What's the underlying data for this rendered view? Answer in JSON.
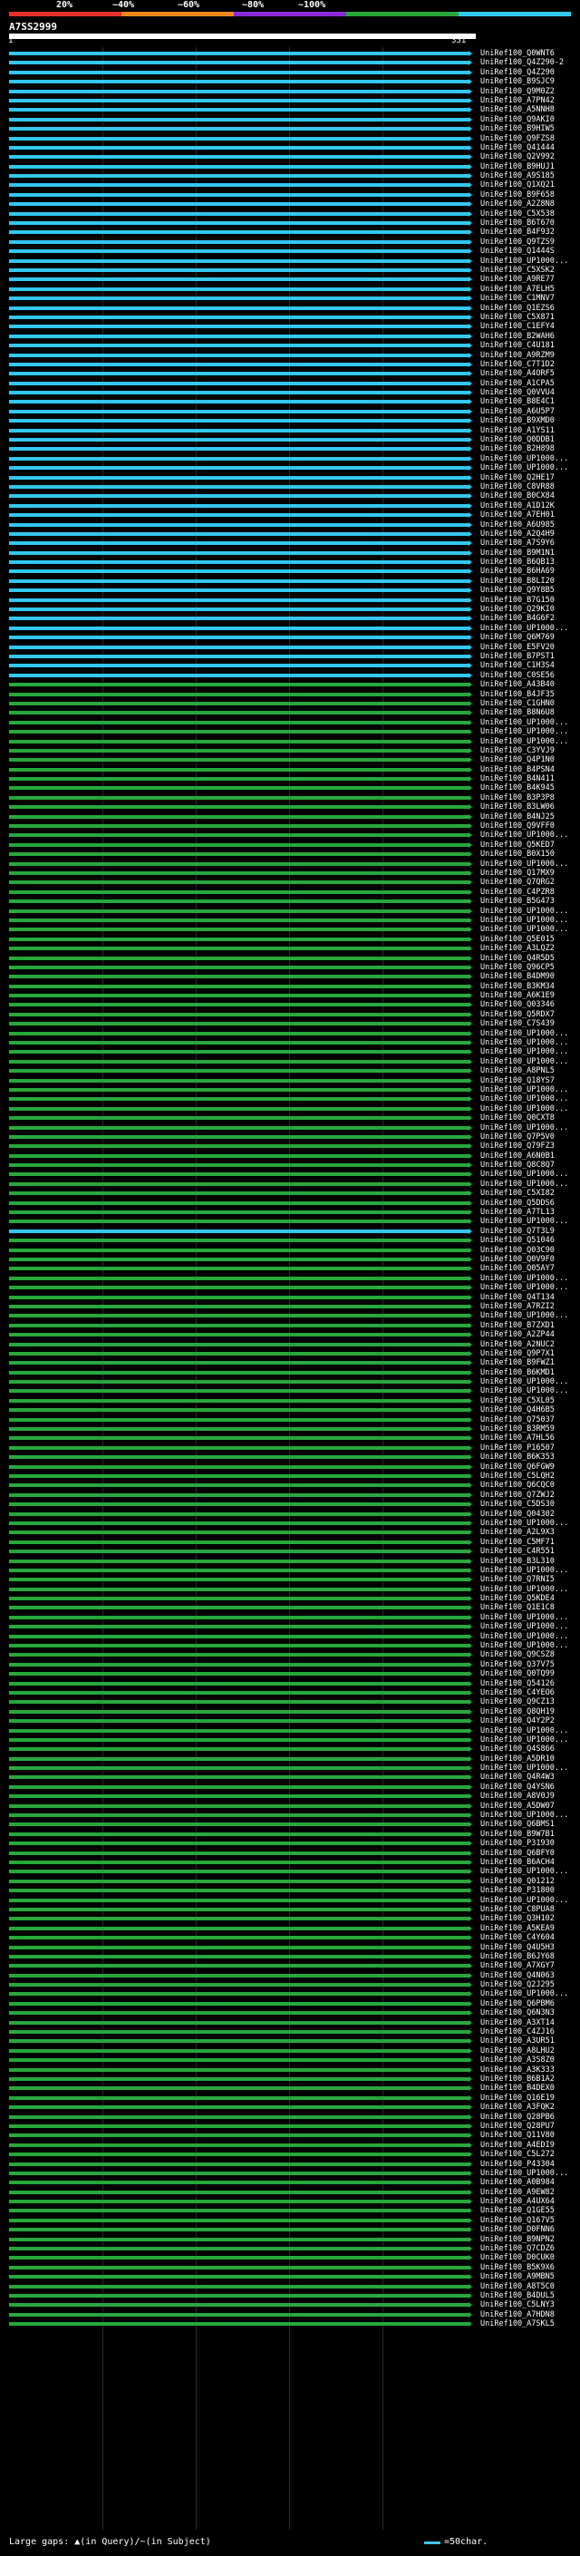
{
  "header": {
    "percent_labels": [
      "20%",
      "~40%",
      "~60%",
      "~80%",
      "~100%"
    ],
    "colors": [
      "#e8312a",
      "#f08a1d",
      "#8a2bd6",
      "#28a83c",
      "#32c8f0"
    ]
  },
  "query": {
    "id": "A7SS2999",
    "start": "1",
    "end": "351"
  },
  "hits": [
    "UniRef100_Q0WNT6",
    "UniRef100_Q4Z290-2",
    "UniRef100_Q4Z290",
    "UniRef100_B9SJC9",
    "UniRef100_Q9M0Z2",
    "UniRef100_A7PN42",
    "UniRef100_A5NNH8",
    "UniRef100_Q9AKI0",
    "UniRef100_B9HIW5",
    "UniRef100_Q9FZS8",
    "UniRef100_Q41444",
    "UniRef100_Q2V992",
    "UniRef100_B9HUJ1",
    "UniRef100_A9S185",
    "UniRef100_Q1XQ21",
    "UniRef100_B9F658",
    "UniRef100_A2Z8N8",
    "UniRef100_C5X538",
    "UniRef100_B6T670",
    "UniRef100_B4F932",
    "UniRef100_Q9TZS9",
    "UniRef100_Q1444S",
    "UniRef100_UP1000...",
    "UniRef100_C5XSK2",
    "UniRef100_A9RE77",
    "UniRef100_A7ELH5",
    "UniRef100_C1MNV7",
    "UniRef100_Q1EZS6",
    "UniRef100_C5X871",
    "UniRef100_C1EFY4",
    "UniRef100_B2WAH6",
    "UniRef100_C4U181",
    "UniRef100_A9RZM9",
    "UniRef100_C7T1D2",
    "UniRef100_A4ORF5",
    "UniRef100_A1CPA5",
    "UniRef100_Q0VVU4",
    "UniRef100_B8E4C1",
    "UniRef100_A6U5P7",
    "UniRef100_B9XMD0",
    "UniRef100_A1YS11",
    "UniRef100_Q0DDB1",
    "UniRef100_B2H898",
    "UniRef100_UP1000...",
    "UniRef100_UP1000...",
    "UniRef100_Q2HE17",
    "UniRef100_C8VR88",
    "UniRef100_B0CX84",
    "UniRef100_A1D12K",
    "UniRef100_A7EH01",
    "UniRef100_A6U985",
    "UniRef100_A2Q4H9",
    "UniRef100_A7S9Y6",
    "UniRef100_B9M1N1",
    "UniRef100_B6QB13",
    "UniRef100_B6HA69",
    "UniRef100_B8LI20",
    "UniRef100_Q9Y8B5",
    "UniRef100_B7G150",
    "UniRef100_Q29KI0",
    "UniRef100_B4G6F2",
    "UniRef100_UP1000...",
    "UniRef100_Q6M769",
    "UniRef100_E5FV20",
    "UniRef100_B7PST1",
    "UniRef100_C1H3S4",
    "UniRef100_C0SE56",
    "UniRef100_A43B40",
    "UniRef100_B4JF35",
    "UniRef100_C1GHN0",
    "UniRef100_B8N6U8",
    "UniRef100_UP1000...",
    "UniRef100_UP1000...",
    "UniRef100_UP1000...",
    "UniRef100_C3YVJ9",
    "UniRef100_Q4P1N0",
    "UniRef100_B4PSN4",
    "UniRef100_B4N411",
    "UniRef100_B4K945",
    "UniRef100_B3P3P8",
    "UniRef100_B3LW06",
    "UniRef100_B4NJ25",
    "UniRef100_Q9VFF0",
    "UniRef100_UP1000...",
    "UniRef100_Q5KED7",
    "UniRef100_B0X150",
    "UniRef100_UP1000...",
    "UniRef100_Q17MX9",
    "UniRef100_Q7QRG2",
    "UniRef100_C4PZR8",
    "UniRef100_B5G473",
    "UniRef100_UP1000...",
    "UniRef100_UP1000...",
    "UniRef100_UP1000...",
    "UniRef100_Q5E015",
    "UniRef100_A3LQZ2",
    "UniRef100_Q4R5D5",
    "UniRef100_Q96CP5",
    "UniRef100_B4DM90",
    "UniRef100_B3KM34",
    "UniRef100_A6K1E9",
    "UniRef100_Q03346",
    "UniRef100_Q5RDX7",
    "UniRef100_C7S439",
    "UniRef100_UP1000...",
    "UniRef100_UP1000...",
    "UniRef100_UP1000...",
    "UniRef100_UP1000...",
    "UniRef100_A8PNL5",
    "UniRef100_Q18YS7",
    "UniRef100_UP1000...",
    "UniRef100_UP1000...",
    "UniRef100_UP1000...",
    "UniRef100_Q0CXT8",
    "UniRef100_UP1000...",
    "UniRef100_Q7P5V0",
    "UniRef100_Q79FZ3",
    "UniRef100_A6N0B1",
    "UniRef100_Q8C8Q7",
    "UniRef100_UP1000...",
    "UniRef100_UP1000...",
    "UniRef100_C5XI82",
    "UniRef100_Q5DDS6",
    "UniRef100_A7TL13",
    "UniRef100_UP1000...",
    "UniRef100_Q7T3L9",
    "UniRef100_Q51046",
    "UniRef100_Q03C90",
    "UniRef100_Q0V9F0",
    "UniRef100_Q05AY7",
    "UniRef100_UP1000...",
    "UniRef100_UP1000...",
    "UniRef100_Q4T134",
    "UniRef100_A7RZI2",
    "UniRef100_UP1000...",
    "UniRef100_B7ZXD1",
    "UniRef100_A2ZP44",
    "UniRef100_A2NUC2",
    "UniRef100_Q9P7X1",
    "UniRef100_B9FWZ1",
    "UniRef100_B6KMD1",
    "UniRef100_UP1000...",
    "UniRef100_UP1000...",
    "UniRef100_C5XL05",
    "UniRef100_Q4H6B5",
    "UniRef100_Q75037",
    "UniRef100_B3RM59",
    "UniRef100_A7HL56",
    "UniRef100_P16507",
    "UniRef100_B6K353",
    "UniRef100_Q6FGW9",
    "UniRef100_C5LQH2",
    "UniRef100_Q6CQC0",
    "UniRef100_Q7ZWJ2",
    "UniRef100_C5DS30",
    "UniRef100_Q04302",
    "UniRef100_UP1000...",
    "UniRef100_A2L9X3",
    "UniRef100_C5MF71",
    "UniRef100_C4R551",
    "UniRef100_B3L310",
    "UniRef100_UP1000...",
    "UniRef100_Q7RNI5",
    "UniRef100_UP1000...",
    "UniRef100_Q5KDE4",
    "UniRef100_Q1E1C8",
    "UniRef100_UP1000...",
    "UniRef100_UP1000...",
    "UniRef100_UP1000...",
    "UniRef100_UP1000...",
    "UniRef100_Q9CSZ8",
    "UniRef100_Q37V75",
    "UniRef100_Q0TQ99",
    "UniRef100_Q54126",
    "UniRef100_C4YEO6",
    "UniRef100_Q9CZ13",
    "UniRef100_Q8QH19",
    "UniRef100_Q4Y2P2",
    "UniRef100_UP1000...",
    "UniRef100_UP1000...",
    "UniRef100_Q4S866",
    "UniRef100_A5DR10",
    "UniRef100_UP1000...",
    "UniRef100_Q4R4W3",
    "UniRef100_Q4YSN6",
    "UniRef100_A8V0J9",
    "UniRef100_A5DW07",
    "UniRef100_UP1000...",
    "UniRef100_Q6BMS1",
    "UniRef100_B9W7B1",
    "UniRef100_P31930",
    "UniRef100_Q6BFY0",
    "UniRef100_B6ACH4",
    "UniRef100_UP1000...",
    "UniRef100_Q01212",
    "UniRef100_P31800",
    "UniRef100_UP1000...",
    "UniRef100_C8PUA8",
    "UniRef100_Q3H102",
    "UniRef100_A5KEA9",
    "UniRef100_C4Y604",
    "UniRef100_Q4U5H3",
    "UniRef100_B6JY68",
    "UniRef100_A7XGY7",
    "UniRef100_Q4N063",
    "UniRef100_Q2J295",
    "UniRef100_UP1000...",
    "UniRef100_Q6PBM6",
    "UniRef100_Q6N3N3",
    "UniRef100_A3XT14",
    "UniRef100_C4ZJ16",
    "UniRef100_A3UR51",
    "UniRef100_A8LHU2",
    "UniRef100_A3S8Z0",
    "UniRef100_A3K333",
    "UniRef100_B6B1A2",
    "UniRef100_B4DEX0",
    "UniRef100_Q16E19",
    "UniRef100_A3FQK2",
    "UniRef100_Q28PB6",
    "UniRef100_Q28PU7",
    "UniRef100_Q11V80",
    "UniRef100_A4EDI9",
    "UniRef100_C5L272",
    "UniRef100_P43304",
    "UniRef100_UP1000...",
    "UniRef100_A0B984",
    "UniRef100_A9EW82",
    "UniRef100_A4UX64",
    "UniRef100_Q1GE55",
    "UniRef100_Q167V5",
    "UniRef100_D0FNN6",
    "UniRef100_B9NPN2",
    "UniRef100_Q7CDZ6",
    "UniRef100_D0CUK0",
    "UniRef100_B5K9X6",
    "UniRef100_A9MBN5",
    "UniRef100_A8T5C0",
    "UniRef100_B4DUL5",
    "UniRef100_C5LNY3",
    "UniRef100_A7HDN8",
    "UniRef100_A7SKL5"
  ],
  "footer": {
    "large_gaps_label": "Large gaps: ",
    "query_gap_text": "(in Query)/",
    "subject_gap_text": "(in Subject)",
    "scale_text": "=50char."
  }
}
